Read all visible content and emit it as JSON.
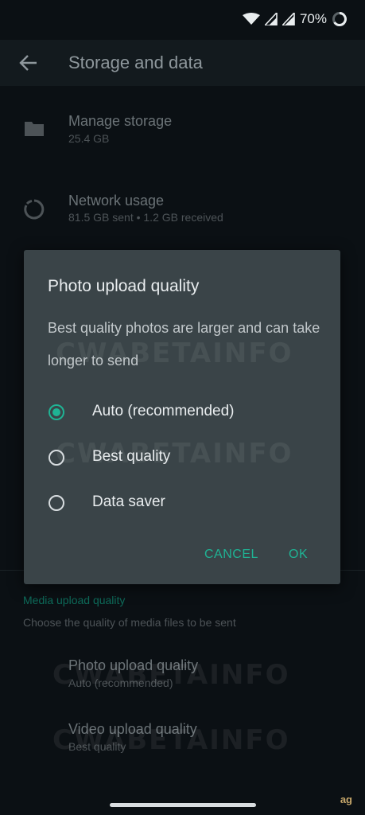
{
  "status_bar": {
    "battery_percent": "70%"
  },
  "app_bar": {
    "title": "Storage and data"
  },
  "settings": {
    "manage_storage": {
      "title": "Manage storage",
      "subtitle": "25.4 GB"
    },
    "network_usage": {
      "title": "Network usage",
      "subtitle": "81.5 GB sent • 1.2 GB received"
    },
    "media_section": {
      "header": "Media upload quality",
      "description": "Choose the quality of media files to be sent"
    },
    "photo_quality": {
      "title": "Photo upload quality",
      "subtitle": "Auto (recommended)"
    },
    "video_quality": {
      "title": "Video upload quality",
      "subtitle": "Best quality"
    }
  },
  "dialog": {
    "title": "Photo upload quality",
    "body": "Best quality photos are larger and can take longer to send",
    "options": [
      {
        "label": "Auto (recommended)",
        "selected": true
      },
      {
        "label": "Best quality",
        "selected": false
      },
      {
        "label": "Data saver",
        "selected": false
      }
    ],
    "cancel_label": "CANCEL",
    "ok_label": "OK"
  },
  "watermark": {
    "text": "CWABETAINFO"
  },
  "corner_logo": {
    "text": "ag"
  },
  "colors": {
    "accent": "#1fb394",
    "dialog_bg": "#3a4448",
    "page_bg": "#0b1014"
  }
}
